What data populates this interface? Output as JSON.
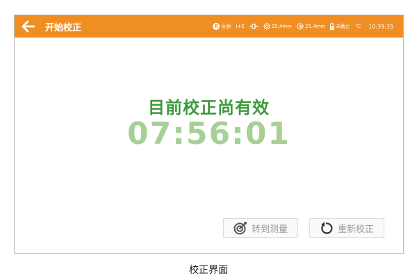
{
  "header": {
    "title": "开始校正",
    "back_icon": "back-arrow-icon",
    "status": {
      "mode_badge": "R",
      "mode_label": "反射",
      "illum_label": "I+E",
      "size_1": "25.4mm",
      "size_2": "25.4mm",
      "battery_label": "未截止",
      "temperature_unit": "℃",
      "time": "10:39:35"
    }
  },
  "main": {
    "message": "目前校正尚有效",
    "countdown": "07:56:01"
  },
  "buttons": {
    "measure_label": "转到测量",
    "measure_icon": "radar-target-icon",
    "recalibrate_label": "重新校正",
    "recalibrate_icon": "rotate-ccw-icon"
  },
  "caption": "校正界面",
  "colors": {
    "header_bg": "#ef8f23",
    "message": "#3c9a3a",
    "countdown": "#a7cf96",
    "button_text": "#9a9a9a"
  }
}
